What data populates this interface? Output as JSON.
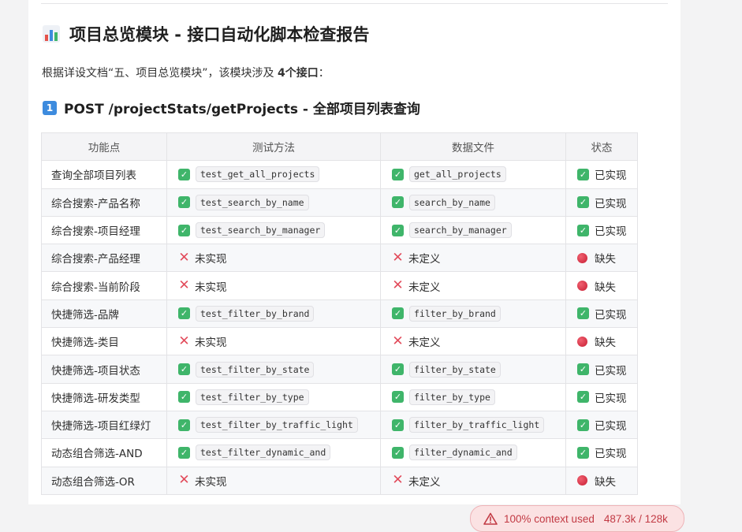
{
  "heading": {
    "icon": "bar-chart-icon",
    "title": "项目总览模块 - 接口自动化脚本检查报告"
  },
  "intro": {
    "prefix": "根据详设文档“五、项目总览模块”，该模块涉及 ",
    "count_bold": "4个接口",
    "suffix": "："
  },
  "section": {
    "badge": "1",
    "title": "POST /projectStats/getProjects - 全部项目列表查询"
  },
  "table": {
    "headers": [
      "功能点",
      "测试方法",
      "数据文件",
      "状态"
    ],
    "rows": [
      {
        "feature": "查询全部项目列表",
        "method": "test_get_all_projects",
        "data_file": "get_all_projects",
        "status": "已实现",
        "ok": true
      },
      {
        "feature": "综合搜索-产品名称",
        "method": "test_search_by_name",
        "data_file": "search_by_name",
        "status": "已实现",
        "ok": true
      },
      {
        "feature": "综合搜索-项目经理",
        "method": "test_search_by_manager",
        "data_file": "search_by_manager",
        "status": "已实现",
        "ok": true
      },
      {
        "feature": "综合搜索-产品经理",
        "method": "未实现",
        "data_file": "未定义",
        "status": "缺失",
        "ok": false
      },
      {
        "feature": "综合搜索-当前阶段",
        "method": "未实现",
        "data_file": "未定义",
        "status": "缺失",
        "ok": false
      },
      {
        "feature": "快捷筛选-品牌",
        "method": "test_filter_by_brand",
        "data_file": "filter_by_brand",
        "status": "已实现",
        "ok": true
      },
      {
        "feature": "快捷筛选-类目",
        "method": "未实现",
        "data_file": "未定义",
        "status": "缺失",
        "ok": false
      },
      {
        "feature": "快捷筛选-项目状态",
        "method": "test_filter_by_state",
        "data_file": "filter_by_state",
        "status": "已实现",
        "ok": true
      },
      {
        "feature": "快捷筛选-研发类型",
        "method": "test_filter_by_type",
        "data_file": "filter_by_type",
        "status": "已实现",
        "ok": true
      },
      {
        "feature": "快捷筛选-项目红绿灯",
        "method": "test_filter_by_traffic_light",
        "data_file": "filter_by_traffic_light",
        "status": "已实现",
        "ok": true
      },
      {
        "feature": "动态组合筛选-AND",
        "method": "test_filter_dynamic_and",
        "data_file": "filter_dynamic_and",
        "status": "已实现",
        "ok": true
      },
      {
        "feature": "动态组合筛选-OR",
        "method": "未实现",
        "data_file": "未定义",
        "status": "缺失",
        "ok": false
      }
    ]
  },
  "context_warning": {
    "icon": "warning-triangle-icon",
    "label": "100% context used",
    "usage": "487.3k / 128k"
  },
  "colors": {
    "ok": "#3fb56a",
    "missing": "#e24b5b",
    "warning_bg": "#fbe2e3",
    "warning_text": "#c23a44"
  }
}
